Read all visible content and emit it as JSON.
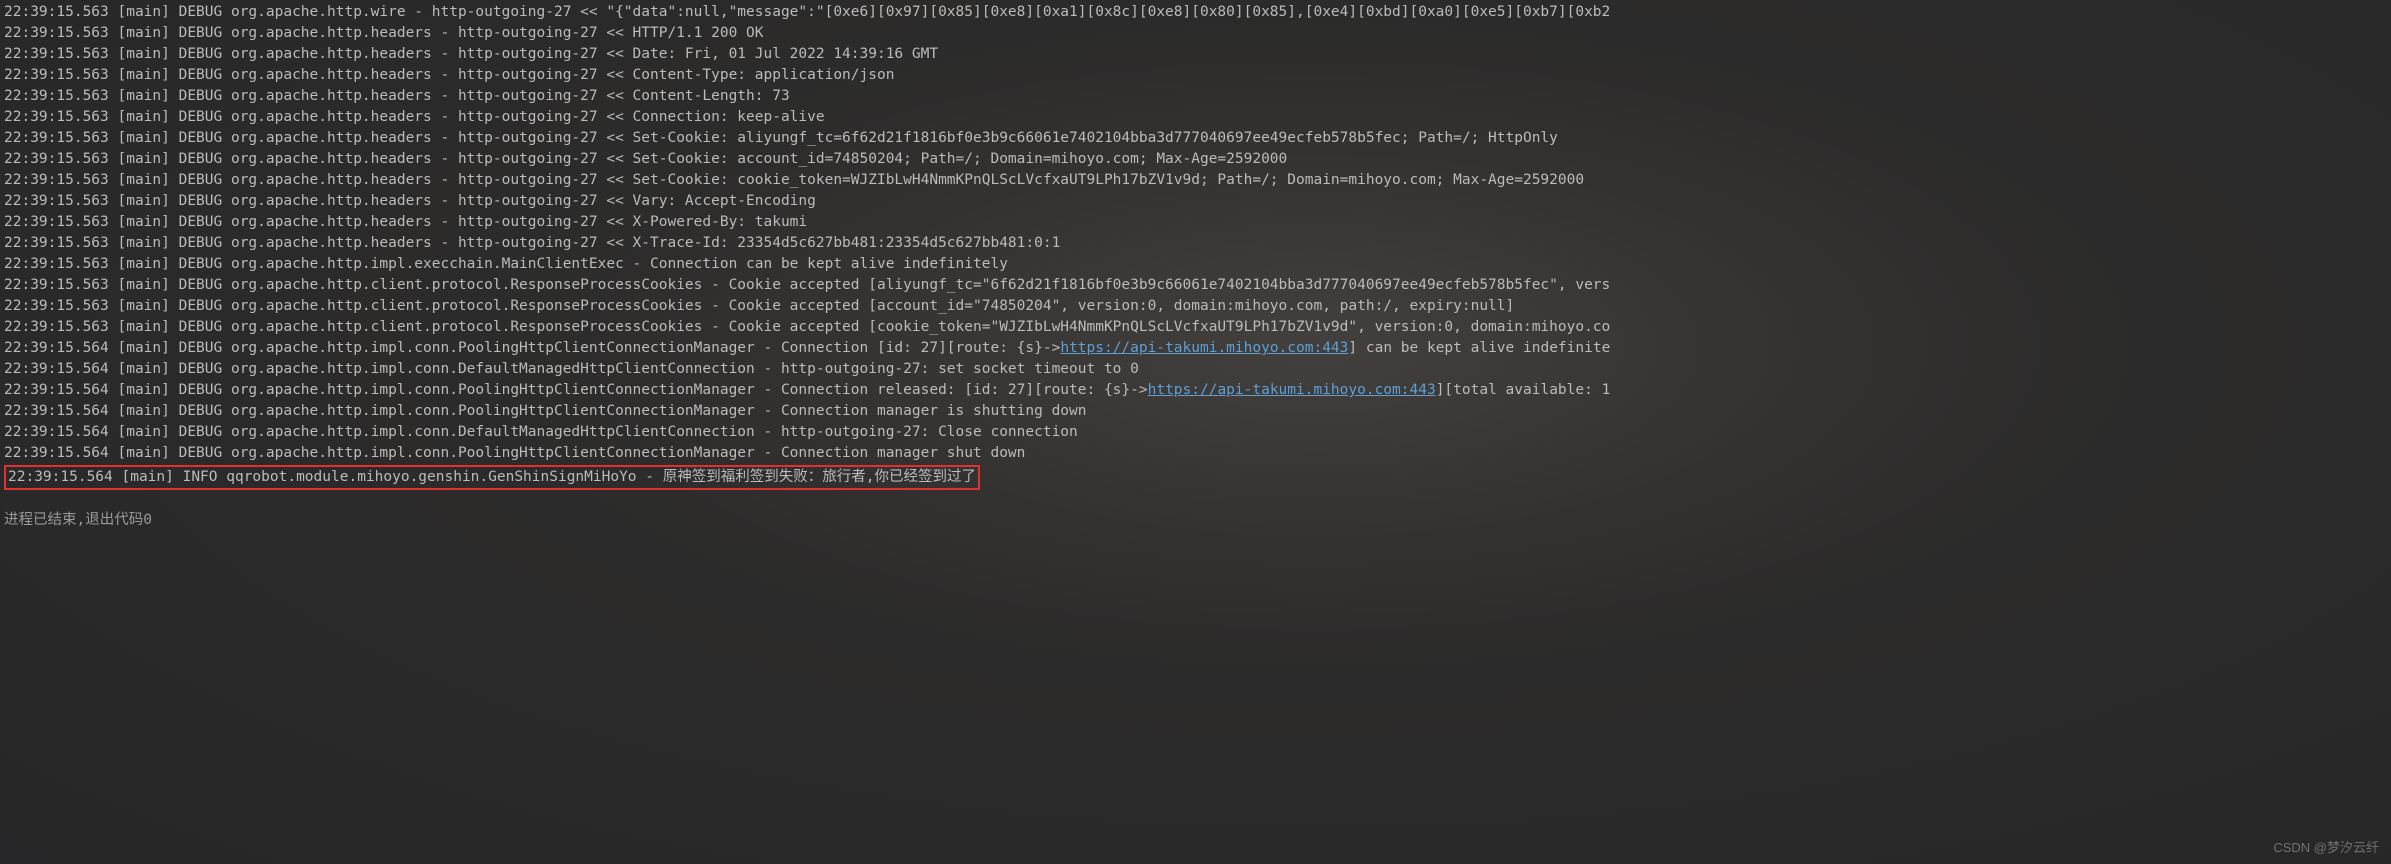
{
  "lines": [
    {
      "t": "plain",
      "text": "22:39:15.563 [main] DEBUG org.apache.http.wire - http-outgoing-27 << \"{\"data\":null,\"message\":\"[0xe6][0x97][0x85][0xe8][0xa1][0x8c][0xe8][0x80][0x85],[0xe4][0xbd][0xa0][0xe5][0xb7][0xb2"
    },
    {
      "t": "plain",
      "text": "22:39:15.563 [main] DEBUG org.apache.http.headers - http-outgoing-27 << HTTP/1.1 200 OK"
    },
    {
      "t": "plain",
      "text": "22:39:15.563 [main] DEBUG org.apache.http.headers - http-outgoing-27 << Date: Fri, 01 Jul 2022 14:39:16 GMT"
    },
    {
      "t": "plain",
      "text": "22:39:15.563 [main] DEBUG org.apache.http.headers - http-outgoing-27 << Content-Type: application/json"
    },
    {
      "t": "plain",
      "text": "22:39:15.563 [main] DEBUG org.apache.http.headers - http-outgoing-27 << Content-Length: 73"
    },
    {
      "t": "plain",
      "text": "22:39:15.563 [main] DEBUG org.apache.http.headers - http-outgoing-27 << Connection: keep-alive"
    },
    {
      "t": "plain",
      "text": "22:39:15.563 [main] DEBUG org.apache.http.headers - http-outgoing-27 << Set-Cookie: aliyungf_tc=6f62d21f1816bf0e3b9c66061e7402104bba3d777040697ee49ecfeb578b5fec; Path=/; HttpOnly"
    },
    {
      "t": "plain",
      "text": "22:39:15.563 [main] DEBUG org.apache.http.headers - http-outgoing-27 << Set-Cookie: account_id=74850204; Path=/; Domain=mihoyo.com; Max-Age=2592000"
    },
    {
      "t": "plain",
      "text": "22:39:15.563 [main] DEBUG org.apache.http.headers - http-outgoing-27 << Set-Cookie: cookie_token=WJZIbLwH4NmmKPnQLScLVcfxaUT9LPh17bZV1v9d; Path=/; Domain=mihoyo.com; Max-Age=2592000"
    },
    {
      "t": "plain",
      "text": "22:39:15.563 [main] DEBUG org.apache.http.headers - http-outgoing-27 << Vary: Accept-Encoding"
    },
    {
      "t": "plain",
      "text": "22:39:15.563 [main] DEBUG org.apache.http.headers - http-outgoing-27 << X-Powered-By: takumi"
    },
    {
      "t": "plain",
      "text": "22:39:15.563 [main] DEBUG org.apache.http.headers - http-outgoing-27 << X-Trace-Id: 23354d5c627bb481:23354d5c627bb481:0:1"
    },
    {
      "t": "plain",
      "text": "22:39:15.563 [main] DEBUG org.apache.http.impl.execchain.MainClientExec - Connection can be kept alive indefinitely"
    },
    {
      "t": "plain",
      "text": "22:39:15.563 [main] DEBUG org.apache.http.client.protocol.ResponseProcessCookies - Cookie accepted [aliyungf_tc=\"6f62d21f1816bf0e3b9c66061e7402104bba3d777040697ee49ecfeb578b5fec\", vers"
    },
    {
      "t": "plain",
      "text": "22:39:15.563 [main] DEBUG org.apache.http.client.protocol.ResponseProcessCookies - Cookie accepted [account_id=\"74850204\", version:0, domain:mihoyo.com, path:/, expiry:null]"
    },
    {
      "t": "plain",
      "text": "22:39:15.563 [main] DEBUG org.apache.http.client.protocol.ResponseProcessCookies - Cookie accepted [cookie_token=\"WJZIbLwH4NmmKPnQLScLVcfxaUT9LPh17bZV1v9d\", version:0, domain:mihoyo.co"
    },
    {
      "t": "link",
      "pre": "22:39:15.564 [main] DEBUG org.apache.http.impl.conn.PoolingHttpClientConnectionManager - Connection [id: 27][route: {s}->",
      "url": "https://api-takumi.mihoyo.com:443",
      "post": "] can be kept alive indefinite"
    },
    {
      "t": "plain",
      "text": "22:39:15.564 [main] DEBUG org.apache.http.impl.conn.DefaultManagedHttpClientConnection - http-outgoing-27: set socket timeout to 0"
    },
    {
      "t": "link",
      "pre": "22:39:15.564 [main] DEBUG org.apache.http.impl.conn.PoolingHttpClientConnectionManager - Connection released: [id: 27][route: {s}->",
      "url": "https://api-takumi.mihoyo.com:443",
      "post": "][total available: 1"
    },
    {
      "t": "plain",
      "text": "22:39:15.564 [main] DEBUG org.apache.http.impl.conn.PoolingHttpClientConnectionManager - Connection manager is shutting down"
    },
    {
      "t": "plain",
      "text": "22:39:15.564 [main] DEBUG org.apache.http.impl.conn.DefaultManagedHttpClientConnection - http-outgoing-27: Close connection"
    },
    {
      "t": "plain",
      "text": "22:39:15.564 [main] DEBUG org.apache.http.impl.conn.PoolingHttpClientConnectionManager - Connection manager shut down"
    }
  ],
  "highlighted_line": "22:39:15.564 [main] INFO qqrobot.module.mihoyo.genshin.GenShinSignMiHoYo - 原神签到福利签到失败：旅行者,你已经签到过了",
  "exit_message": "进程已结束,退出代码0",
  "watermark": "CSDN @梦汐云纤"
}
